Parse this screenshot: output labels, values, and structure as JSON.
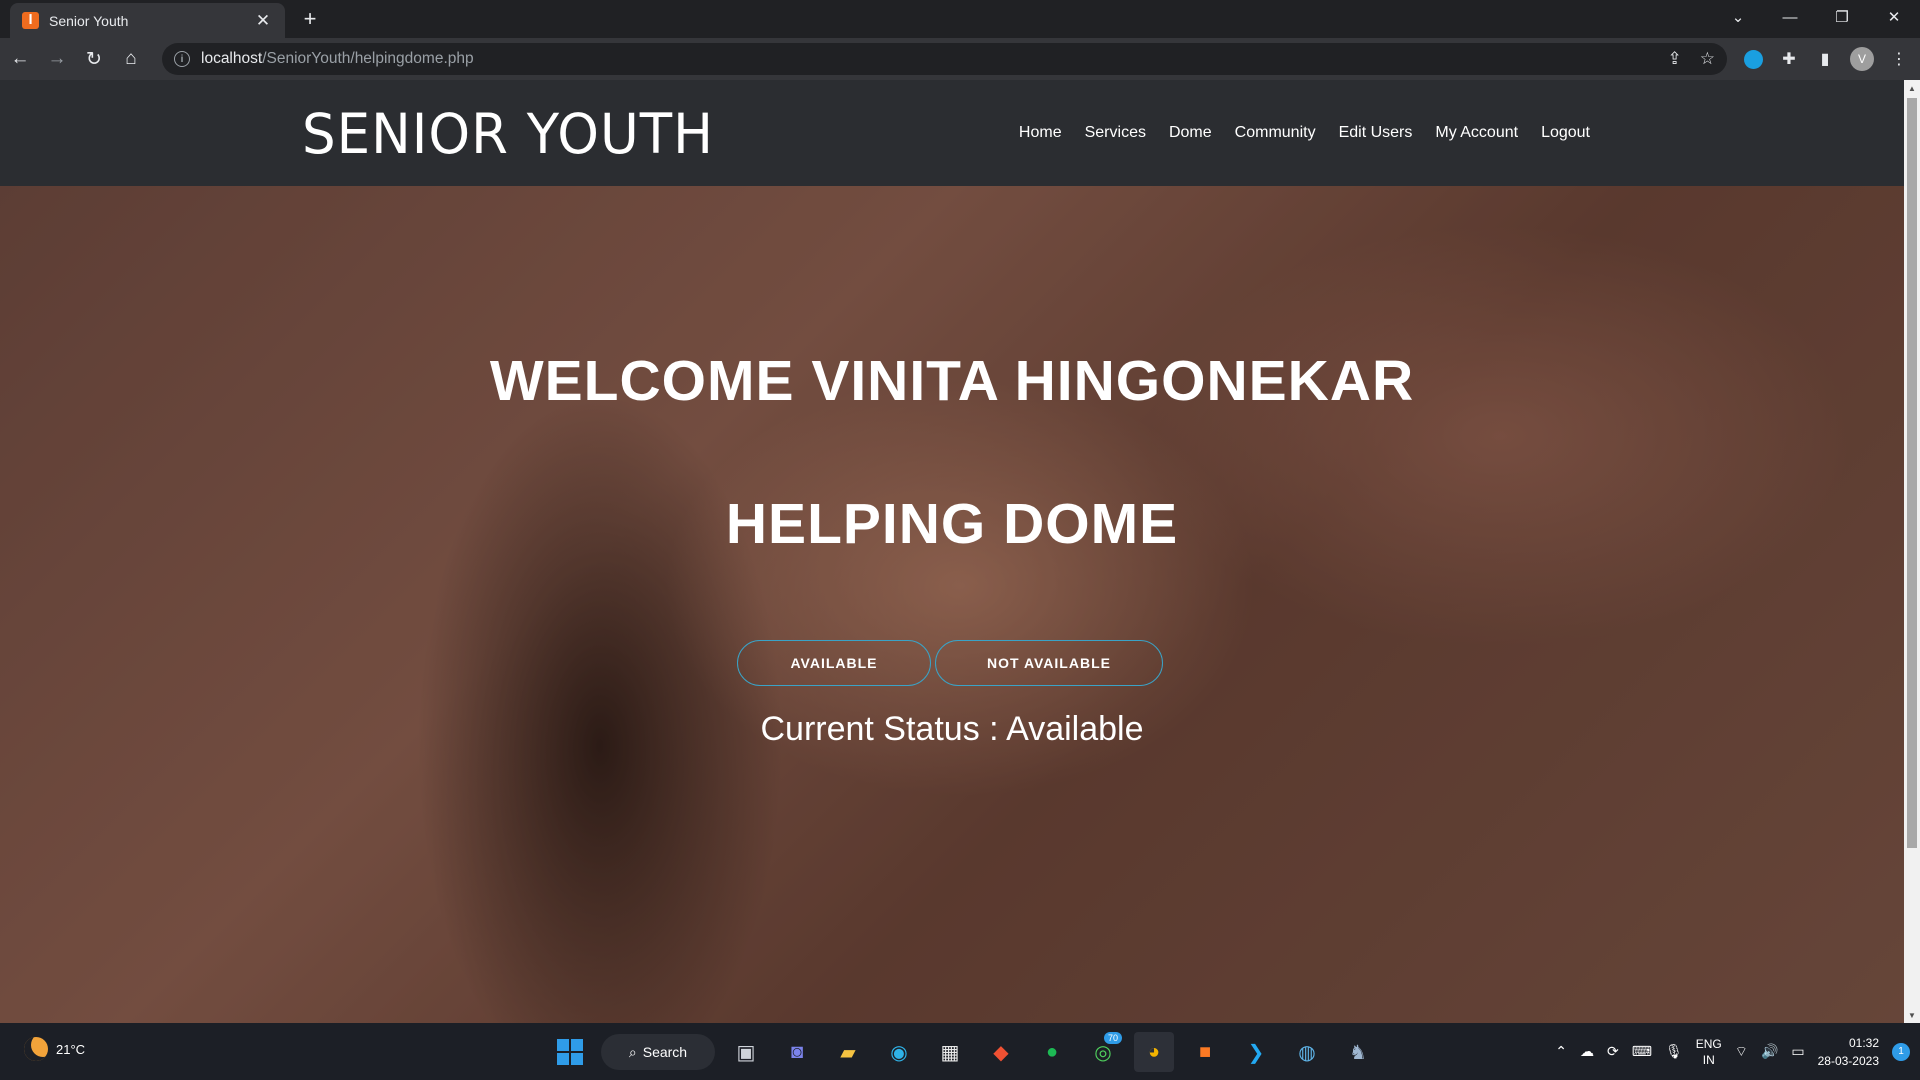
{
  "browser": {
    "tab_title": "Senior Youth",
    "tab_favicon": "xampp-icon",
    "new_tab_label": "+",
    "url_host": "localhost",
    "url_path": "/SeniorYouth/helpingdome.php",
    "profile_initial": "V"
  },
  "site": {
    "brand": "SENIOR YOUTH",
    "nav": [
      {
        "label": "Home"
      },
      {
        "label": "Services"
      },
      {
        "label": "Dome"
      },
      {
        "label": "Community"
      },
      {
        "label": "Edit Users"
      },
      {
        "label": "My Account"
      },
      {
        "label": "Logout"
      }
    ]
  },
  "hero": {
    "welcome": "WELCOME VINITA HINGONEKAR",
    "subtitle": "HELPING DOME",
    "available_button": "AVAILABLE",
    "not_available_button": "NOT AVAILABLE",
    "status_text": "Current Status : Available",
    "button_border_color": "#3aa3c7"
  },
  "taskbar": {
    "temperature": "21°C",
    "search_label": "Search",
    "whatsapp_badge": "70",
    "language_line1": "ENG",
    "language_line2": "IN",
    "time": "01:32",
    "date": "28-03-2023",
    "notification_count": "1"
  }
}
